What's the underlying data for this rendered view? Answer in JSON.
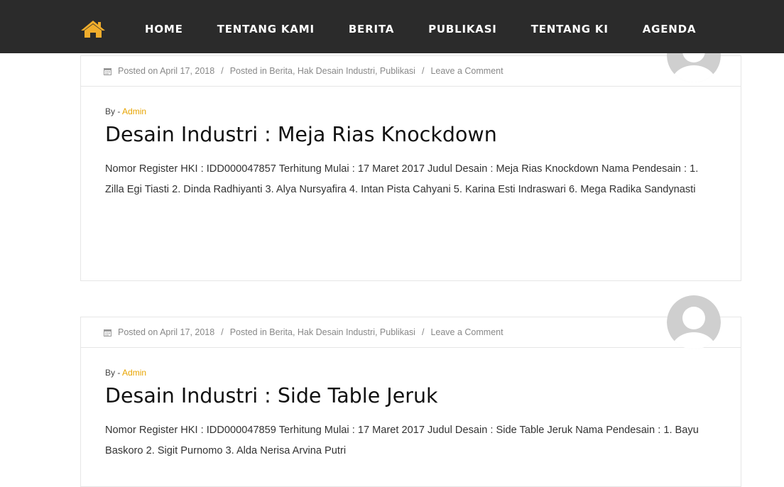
{
  "nav": {
    "home_icon": "home-icon",
    "items": [
      "HOME",
      "TENTANG KAMI",
      "BERITA",
      "PUBLIKASI",
      "TENTANG KI",
      "AGENDA"
    ]
  },
  "colors": {
    "navbar_bg": "#2b2b2b",
    "accent": "#f0ad2c",
    "author_link": "#e8a400"
  },
  "posts": [
    {
      "meta": {
        "posted_on": "Posted on April 17, 2018",
        "sep1": "/",
        "posted_in": "Posted in Berita, Hak Desain Industri, Publikasi",
        "sep2": "/",
        "comment": "Leave a Comment"
      },
      "by_prefix": "By - ",
      "author": "Admin",
      "title": "Desain Industri : Meja Rias Knockdown",
      "excerpt": "Nomor Register HKI : IDD000047857 Terhitung Mulai : 17 Maret 2017 Judul Desain : Meja Rias Knockdown Nama Pendesain : 1. Zilla Egi Tiasti 2. Dinda Radhiyanti 3. Alya Nursyafira 4. Intan Pista Cahyani 5. Karina Esti Indraswari 6. Mega Radika Sandynasti"
    },
    {
      "meta": {
        "posted_on": "Posted on April 17, 2018",
        "sep1": "/",
        "posted_in": "Posted in Berita, Hak Desain Industri, Publikasi",
        "sep2": "/",
        "comment": "Leave a Comment"
      },
      "by_prefix": "By - ",
      "author": "Admin",
      "title": "Desain Industri : Side Table Jeruk",
      "excerpt": "Nomor Register HKI : IDD000047859 Terhitung Mulai : 17 Maret 2017 Judul Desain : Side Table Jeruk Nama Pendesain : 1. Bayu Baskoro 2. Sigit Purnomo 3. Alda Nerisa Arvina Putri"
    }
  ]
}
